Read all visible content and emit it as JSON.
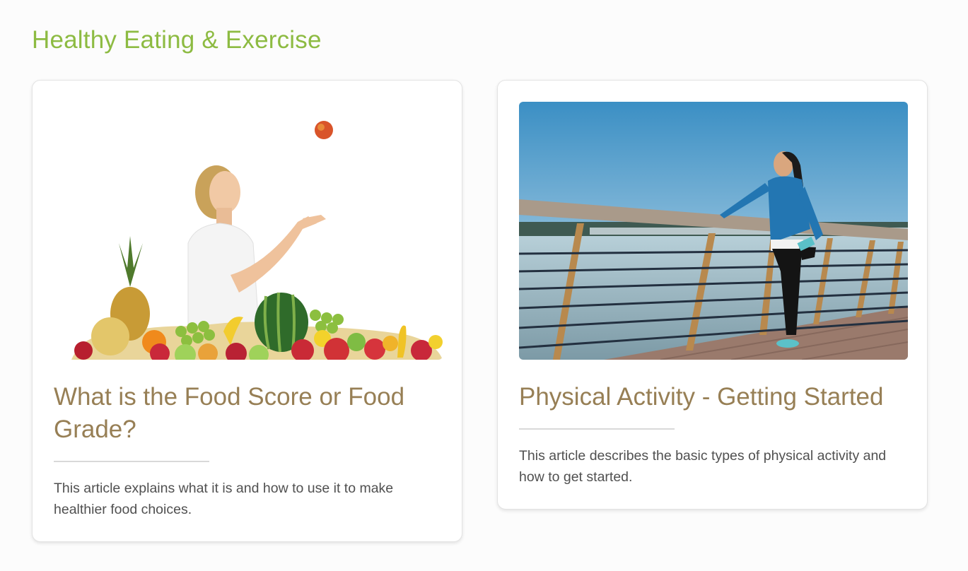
{
  "section": {
    "title": "Healthy Eating & Exercise"
  },
  "articles": [
    {
      "image": "woman-juggling-fruit-photo",
      "title": "What is the Food Score or Food Grade?",
      "description": "This article explains what it is and how to use it to make healthier food choices."
    },
    {
      "image": "woman-stretching-by-river-photo",
      "title": "Physical Activity - Getting Started",
      "description": "This article describes the basic types of physical activity and how to get started."
    }
  ],
  "colors": {
    "section_title": "#8dbb42",
    "card_title": "#977f55",
    "body_text": "#505050",
    "background": "#fcfcfc"
  }
}
